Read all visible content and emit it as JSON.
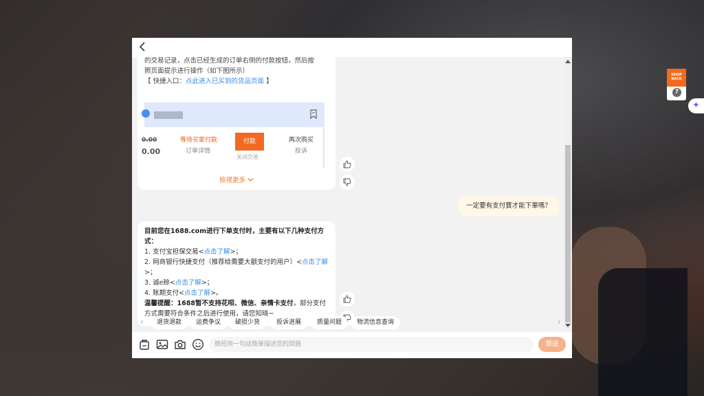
{
  "side_widget": {
    "shop_badge_text": "SHOP BACK",
    "help_glyph": "?",
    "sparkle_glyph": "✦"
  },
  "chat": {
    "back_glyph": "<",
    "bot_message_1": {
      "line_1": "的交易记录，点击已经生成的订单右侧的付款按钮，然后按",
      "line_2": "照页面提示进行操作（如下图所示）",
      "quick_entry_prefix": "【 快捷入口：",
      "quick_entry_link": "点此进入已买到的货品页面",
      "quick_entry_suffix": " 】",
      "order_card": {
        "price_strike": "0.00",
        "price": "0.00",
        "status": "等待买家付款",
        "order_detail": "订单详情",
        "pay_label": "付款",
        "close_trade": "关闭交易",
        "rebuy": "再次购买",
        "complaint": "投诉"
      },
      "view_more": "檢視更多"
    },
    "user_message": "一定要有支付寶才能下單嗎？",
    "bot_message_2": {
      "intro": "目前您在1688.com进行下单支付时，主要有以下几种支付方式：",
      "item_1_text": "1. 支付宝担保交易<",
      "item_1_link": "点击了解",
      "item_1_end": ">；",
      "item_2_text": "2. 网商银行快捷支付（推荐给需要大额支付的用户）<",
      "item_2_link_a": "点击了解",
      "item_2_end": ">；",
      "item_3_text": "3. 诚e赊<",
      "item_3_link": "点击了解",
      "item_3_end": ">；",
      "item_4_text": "4. 账期支付<",
      "item_4_link": "点击了解",
      "item_4_end": ">。",
      "tip_bold": "温馨提醒：1688暂不支持花呗、微信、亲情卡支付",
      "tip_rest": "，部分支付方式需要符合条件之后进行使用，请您知晓~"
    },
    "quick_chips": [
      "退货退款",
      "运费争议",
      "破损少货",
      "投诉进展",
      "质量问题",
      "物流信息查询"
    ],
    "input_placeholder": "簡短用一句話簡單描述您的問題",
    "send_label": "發送"
  },
  "colors": {
    "accent_orange": "#f26a21",
    "link_blue": "#3a8ee6",
    "user_bubble": "#fff7e8"
  }
}
